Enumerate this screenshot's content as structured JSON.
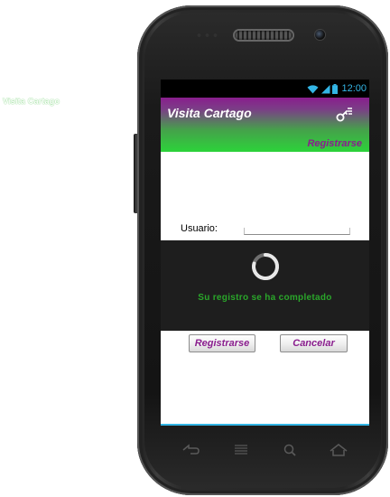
{
  "desktop": {
    "label": "Visita Cartago"
  },
  "statusbar": {
    "time": "12:00"
  },
  "header": {
    "title": "Visita Cartago",
    "register_link": "Registrarse"
  },
  "form": {
    "user_label": "Usuario:",
    "user_value": "",
    "user_placeholder": ""
  },
  "dialog": {
    "message": "Su registro se ha completado"
  },
  "buttons": {
    "register_label": "Registrarse",
    "cancel_label": "Cancelar"
  },
  "icons": {
    "wifi": "wifi-icon",
    "signal": "signal-icon",
    "battery": "battery-icon",
    "menu": "key-menu-icon",
    "spinner": "spinner-icon",
    "back": "back-icon",
    "home": "home-icon",
    "recent": "menu-icon",
    "search": "search-icon"
  },
  "colors": {
    "accent_purple": "#8a1e8e",
    "accent_green": "#2cd33a",
    "status_blue": "#33b5e5",
    "success_green": "#2aa62a"
  }
}
